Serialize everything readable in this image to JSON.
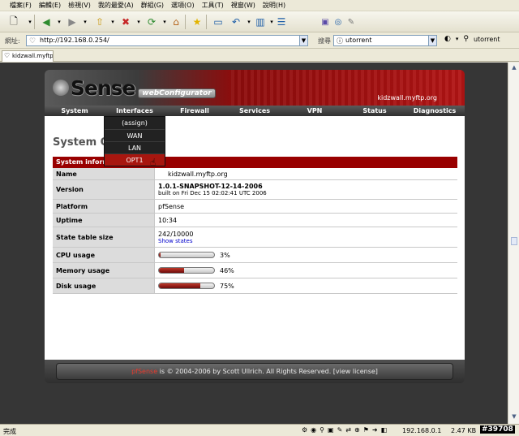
{
  "menu": [
    "檔案(F)",
    "編輯(E)",
    "檢視(V)",
    "我的最愛(A)",
    "群組(G)",
    "選項(O)",
    "工具(T)",
    "視窗(W)",
    "說明(H)"
  ],
  "address": {
    "label": "網址:",
    "url": "http://192.168.0.254/"
  },
  "search": {
    "label": "搜尋",
    "query": "utorrent",
    "right_text": "utorrent"
  },
  "tab": {
    "title": "kidzwall.myftp..."
  },
  "pf": {
    "logo": "Sense",
    "webconfig": "webConfigurator",
    "host": "kidzwall.myftp.org",
    "nav": [
      "System",
      "Interfaces",
      "Firewall",
      "Services",
      "VPN",
      "Status",
      "Diagnostics"
    ],
    "page_title": "System Overview",
    "dropdown": [
      "(assign)",
      "WAN",
      "LAN",
      "OPT1"
    ],
    "dropdown_active": "OPT1",
    "section_header": "System information",
    "rows": {
      "name": {
        "label": "Name",
        "value": "kidzwall.myftp.org"
      },
      "version": {
        "label": "Version",
        "value": "1.0.1-SNAPSHOT-12-14-2006",
        "sub": "built on Fri Dec 15 02:02:41 UTC 2006"
      },
      "platform": {
        "label": "Platform",
        "value": "pfSense"
      },
      "uptime": {
        "label": "Uptime",
        "value": "10:34"
      },
      "state_table": {
        "label": "State table size",
        "value": "242/10000",
        "link": "Show states"
      },
      "cpu": {
        "label": "CPU usage",
        "value": "3%",
        "percent": 3
      },
      "memory": {
        "label": "Memory usage",
        "value": "46%",
        "percent": 46
      },
      "disk": {
        "label": "Disk usage",
        "value": "75%",
        "percent": 75
      }
    },
    "footer": {
      "brand": "pfSense",
      "text": " is © 2004-2006 by Scott Ullrich. All Rights Reserved. [view license]"
    }
  },
  "status": {
    "done": "完成",
    "ip": "192.168.0.1",
    "size": "2.47 KB",
    "watermark": "#39708"
  }
}
